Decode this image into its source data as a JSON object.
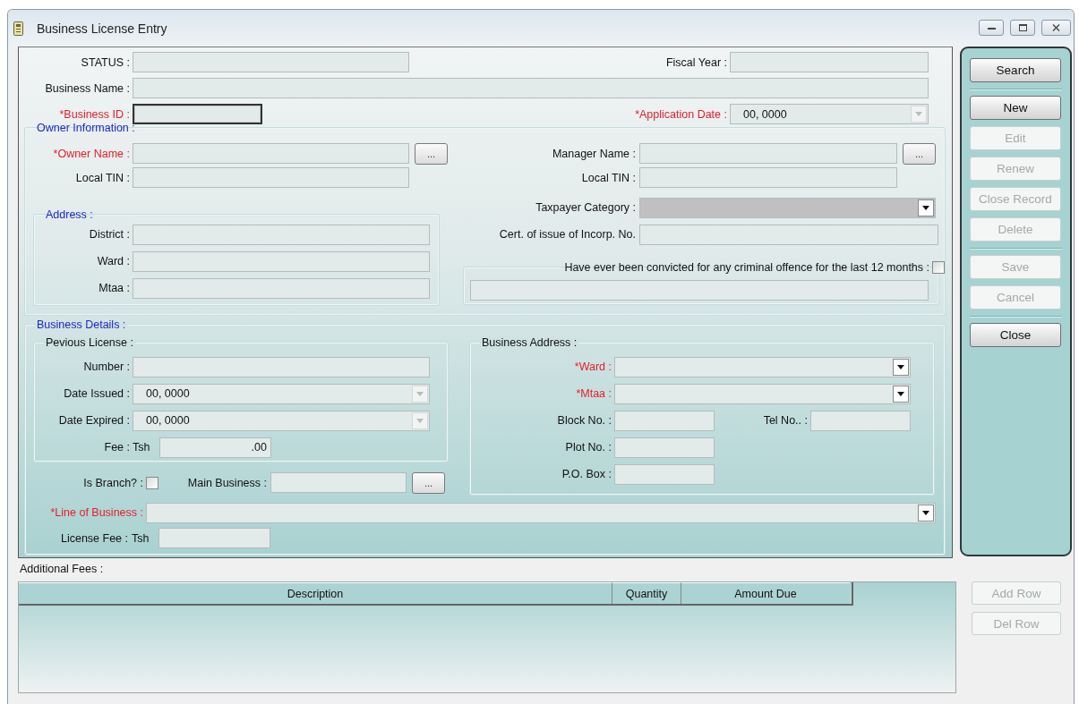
{
  "window": {
    "title": "Business License Entry"
  },
  "header": {
    "status": {
      "label": "STATUS :"
    },
    "fiscal_year": {
      "label": "Fiscal Year :"
    },
    "business_name": {
      "label": "Business Name :"
    },
    "business_id": {
      "label": "*Business ID :",
      "required": true,
      "focused": true
    },
    "application_date": {
      "label": "*Application Date :",
      "required": true,
      "value": "00, 0000",
      "disabled": true
    }
  },
  "owner_information": {
    "title": "Owner Information :",
    "owner_name": {
      "label": "*Owner Name :",
      "required": true,
      "button": "..."
    },
    "local_tin": {
      "label": "Local TIN :"
    },
    "address": {
      "title": "Address :",
      "fields": [
        {
          "label": "District :"
        },
        {
          "label": "Ward :"
        },
        {
          "label": "Mtaa :"
        }
      ]
    },
    "manager_name": {
      "label": "Manager Name :",
      "button": "..."
    },
    "manager_local_tin": {
      "label": "Local TIN :"
    },
    "taxpayer_category": {
      "label": "Taxpayer Category  :",
      "shaded": true,
      "disabled": false
    },
    "cert_of_incorporation": {
      "label": "Cert. of issue of Incorp. No."
    },
    "conviction": {
      "label": "Have ever been convicted for any criminal offence for the last 12 months :",
      "checked": false
    }
  },
  "business_details": {
    "title": "Business Details :",
    "previous_license": {
      "title": "Pevious License :",
      "number": {
        "label": "Number :"
      },
      "date_issued": {
        "label": "Date Issued :",
        "value": "00, 0000",
        "disabled": true
      },
      "date_expired": {
        "label": "Date Expired :",
        "value": "00, 0000",
        "disabled": true
      },
      "fee": {
        "label": "Fee :",
        "unit": "Tsh",
        "value": ".00"
      }
    },
    "is_branch": {
      "label": "Is Branch? :",
      "checked": false
    },
    "main_business": {
      "label": "Main Business :",
      "button": "..."
    },
    "business_address": {
      "title": "Business Address :",
      "ward": {
        "label": "*Ward :",
        "required": true,
        "disabled": false
      },
      "mtaa": {
        "label": "*Mtaa :",
        "required": true,
        "disabled": false
      },
      "block_no": {
        "label": "Block No. :"
      },
      "tel_no": {
        "label": "Tel No.. :"
      },
      "plot_no": {
        "label": "Plot No. :"
      },
      "po_box": {
        "label": "P.O. Box :"
      }
    },
    "line_of_business": {
      "label": "*Line of Business :",
      "required": true,
      "disabled": false
    },
    "license_fee": {
      "label": "License Fee :",
      "unit": "Tsh"
    }
  },
  "actions": [
    {
      "buttons": [
        {
          "label": "Search",
          "disabled": false
        }
      ]
    },
    {
      "buttons": [
        {
          "label": "New",
          "disabled": false
        },
        {
          "label": "Edit",
          "disabled": true
        },
        {
          "label": "Renew",
          "disabled": true
        },
        {
          "label": "Close Record",
          "disabled": true
        },
        {
          "label": "Delete",
          "disabled": true
        }
      ]
    },
    {
      "buttons": [
        {
          "label": "Save",
          "disabled": true
        },
        {
          "label": "Cancel",
          "disabled": true
        }
      ]
    },
    {
      "buttons": [
        {
          "label": "Close",
          "disabled": false
        }
      ]
    }
  ],
  "additional_fees": {
    "label": "Additional Fees :",
    "columns": [
      "Description",
      "Quantity",
      "Amount Due"
    ],
    "buttons": [
      {
        "label": "Add Row",
        "disabled": true
      },
      {
        "label": "Del Row",
        "disabled": true
      }
    ]
  }
}
